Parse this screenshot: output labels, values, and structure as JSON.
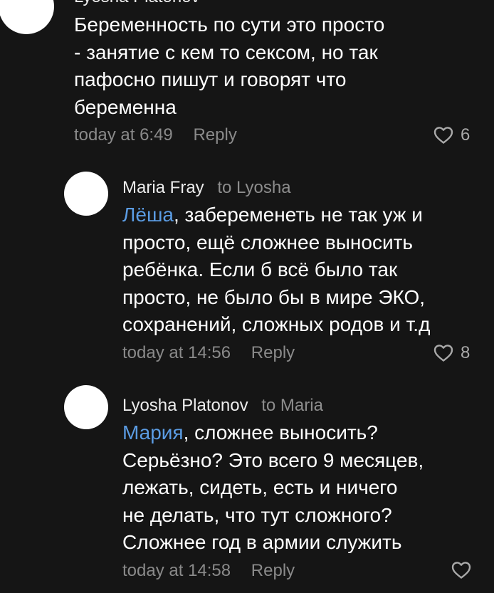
{
  "comments": [
    {
      "author": "Lyosha Platonov",
      "lines": [
        "Беременность по сути это просто",
        "- занятие с кем то сексом, но так",
        "пафосно пишут и говорят что",
        "беременна"
      ],
      "time": "today at 6:49",
      "reply_label": "Reply",
      "likes": "6"
    },
    {
      "author": "Maria Fray",
      "reply_to": "to Lyosha",
      "mention": "Лёша",
      "first_line_rest": ", забеременеть не так уж и",
      "lines": [
        "просто, ещё сложнее выносить",
        "ребёнка. Если б всё было так",
        "просто, не было бы в мире ЭКО,",
        "сохранений, сложных родов и т.д"
      ],
      "time": "today at 14:56",
      "reply_label": "Reply",
      "likes": "8"
    },
    {
      "author": "Lyosha Platonov",
      "reply_to": "to Maria",
      "mention": "Мария",
      "first_line_rest": ", сложнее выносить?",
      "lines": [
        "Серьёзно? Это всего 9 месяцев,",
        "лежать, сидеть, есть и ничего",
        "не делать, что тут сложного?",
        "Сложнее год в армии служить"
      ],
      "time": "today at 14:58",
      "reply_label": "Reply",
      "likes": ""
    }
  ],
  "colors": {
    "background": "#151515",
    "mention": "#5b9ce3",
    "meta": "#8a8a8a"
  },
  "icons": {
    "like": "heart-outline-icon"
  }
}
